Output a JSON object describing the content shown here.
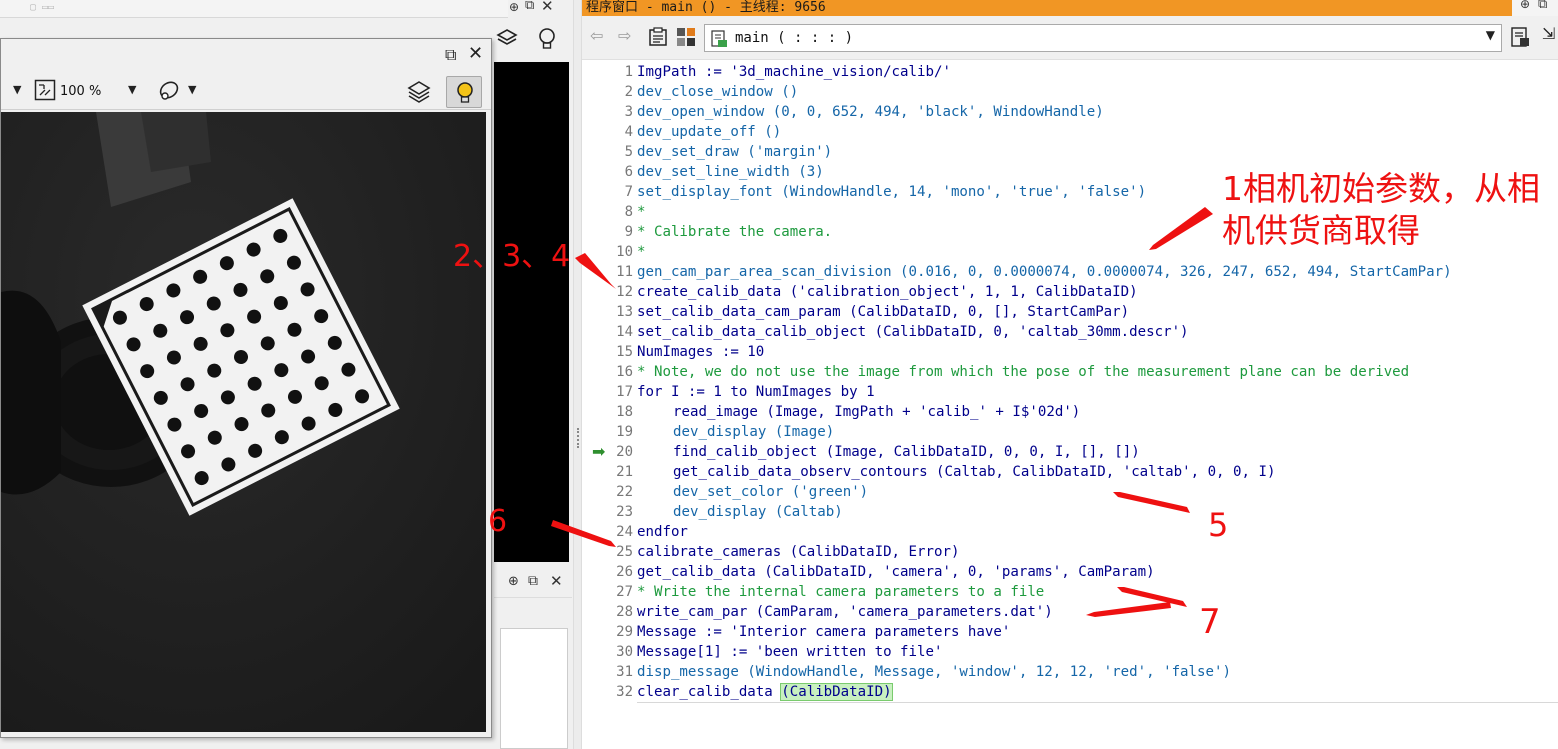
{
  "graphics_window": {
    "zoom": "100 %"
  },
  "program_window": {
    "title": "程序窗口 - main () - 主线程: 9656",
    "procedure": "main ( : : : )"
  },
  "code_lines": [
    {
      "n": "1",
      "text": "ImgPath := '3d_machine_vision/calib/'",
      "kind": "k"
    },
    {
      "n": "2",
      "text": "dev_close_window ()",
      "kind": "b"
    },
    {
      "n": "3",
      "text": "dev_open_window (0, 0, 652, 494, 'black', WindowHandle)",
      "kind": "b"
    },
    {
      "n": "4",
      "text": "dev_update_off ()",
      "kind": "b"
    },
    {
      "n": "5",
      "text": "dev_set_draw ('margin')",
      "kind": "b"
    },
    {
      "n": "6",
      "text": "dev_set_line_width (3)",
      "kind": "b"
    },
    {
      "n": "7",
      "text": "set_display_font (WindowHandle, 14, 'mono', 'true', 'false')",
      "kind": "b"
    },
    {
      "n": "8",
      "text": "*",
      "kind": "c"
    },
    {
      "n": "9",
      "text": "* Calibrate the camera.",
      "kind": "c"
    },
    {
      "n": "10",
      "text": "*",
      "kind": "c"
    },
    {
      "n": "11",
      "text": "gen_cam_par_area_scan_division (0.016, 0, 0.0000074, 0.0000074, 326, 247, 652, 494, StartCamPar)",
      "kind": "b"
    },
    {
      "n": "12",
      "text": "create_calib_data ('calibration_object', 1, 1, CalibDataID)",
      "kind": "k"
    },
    {
      "n": "13",
      "text": "set_calib_data_cam_param (CalibDataID, 0, [], StartCamPar)",
      "kind": "k"
    },
    {
      "n": "14",
      "text": "set_calib_data_calib_object (CalibDataID, 0, 'caltab_30mm.descr')",
      "kind": "k"
    },
    {
      "n": "15",
      "text": "NumImages := 10",
      "kind": "k"
    },
    {
      "n": "16",
      "text": "* Note, we do not use the image from which the pose of the measurement plane can be derived",
      "kind": "c"
    },
    {
      "n": "17",
      "text": "for I := 1 to NumImages by 1",
      "kind": "k"
    },
    {
      "n": "18",
      "text": "read_image (Image, ImgPath + 'calib_' + I$'02d')",
      "kind": "k",
      "indent": true
    },
    {
      "n": "19",
      "text": "dev_display (Image)",
      "kind": "b",
      "indent": true
    },
    {
      "n": "20",
      "text": "find_calib_object (Image, CalibDataID, 0, 0, I, [], [])",
      "kind": "k",
      "indent": true
    },
    {
      "n": "21",
      "text": "get_calib_data_observ_contours (Caltab, CalibDataID, 'caltab', 0, 0, I)",
      "kind": "k",
      "indent": true
    },
    {
      "n": "22",
      "text": "dev_set_color ('green')",
      "kind": "b",
      "indent": true
    },
    {
      "n": "23",
      "text": "dev_display (Caltab)",
      "kind": "b",
      "indent": true
    },
    {
      "n": "24",
      "text": "endfor",
      "kind": "k"
    },
    {
      "n": "25",
      "text": "calibrate_cameras (CalibDataID, Error)",
      "kind": "k"
    },
    {
      "n": "26",
      "text": "get_calib_data (CalibDataID, 'camera', 0, 'params', CamParam)",
      "kind": "k"
    },
    {
      "n": "27",
      "text": "* Write the internal camera parameters to a file",
      "kind": "c"
    },
    {
      "n": "28",
      "text": "write_cam_par (CamParam, 'camera_parameters.dat')",
      "kind": "k"
    },
    {
      "n": "29",
      "text": "Message := 'Interior camera parameters have'",
      "kind": "k"
    },
    {
      "n": "30",
      "text": "Message[1] := 'been written to file'",
      "kind": "k"
    },
    {
      "n": "31",
      "text": "disp_message (WindowHandle, Message, 'window', 12, 12, 'red', 'false')",
      "kind": "b"
    },
    {
      "n": "32",
      "text": "clear_calib_data ",
      "kind": "k",
      "paren": "(CalibDataID)"
    }
  ],
  "annotations": {
    "a1_line1": "1相机初始参数，从相",
    "a1_line2": "机供货商取得",
    "a234": "2、3、4",
    "a5": "5",
    "a6": "6",
    "a7": "7",
    "color": "#ee1111"
  }
}
